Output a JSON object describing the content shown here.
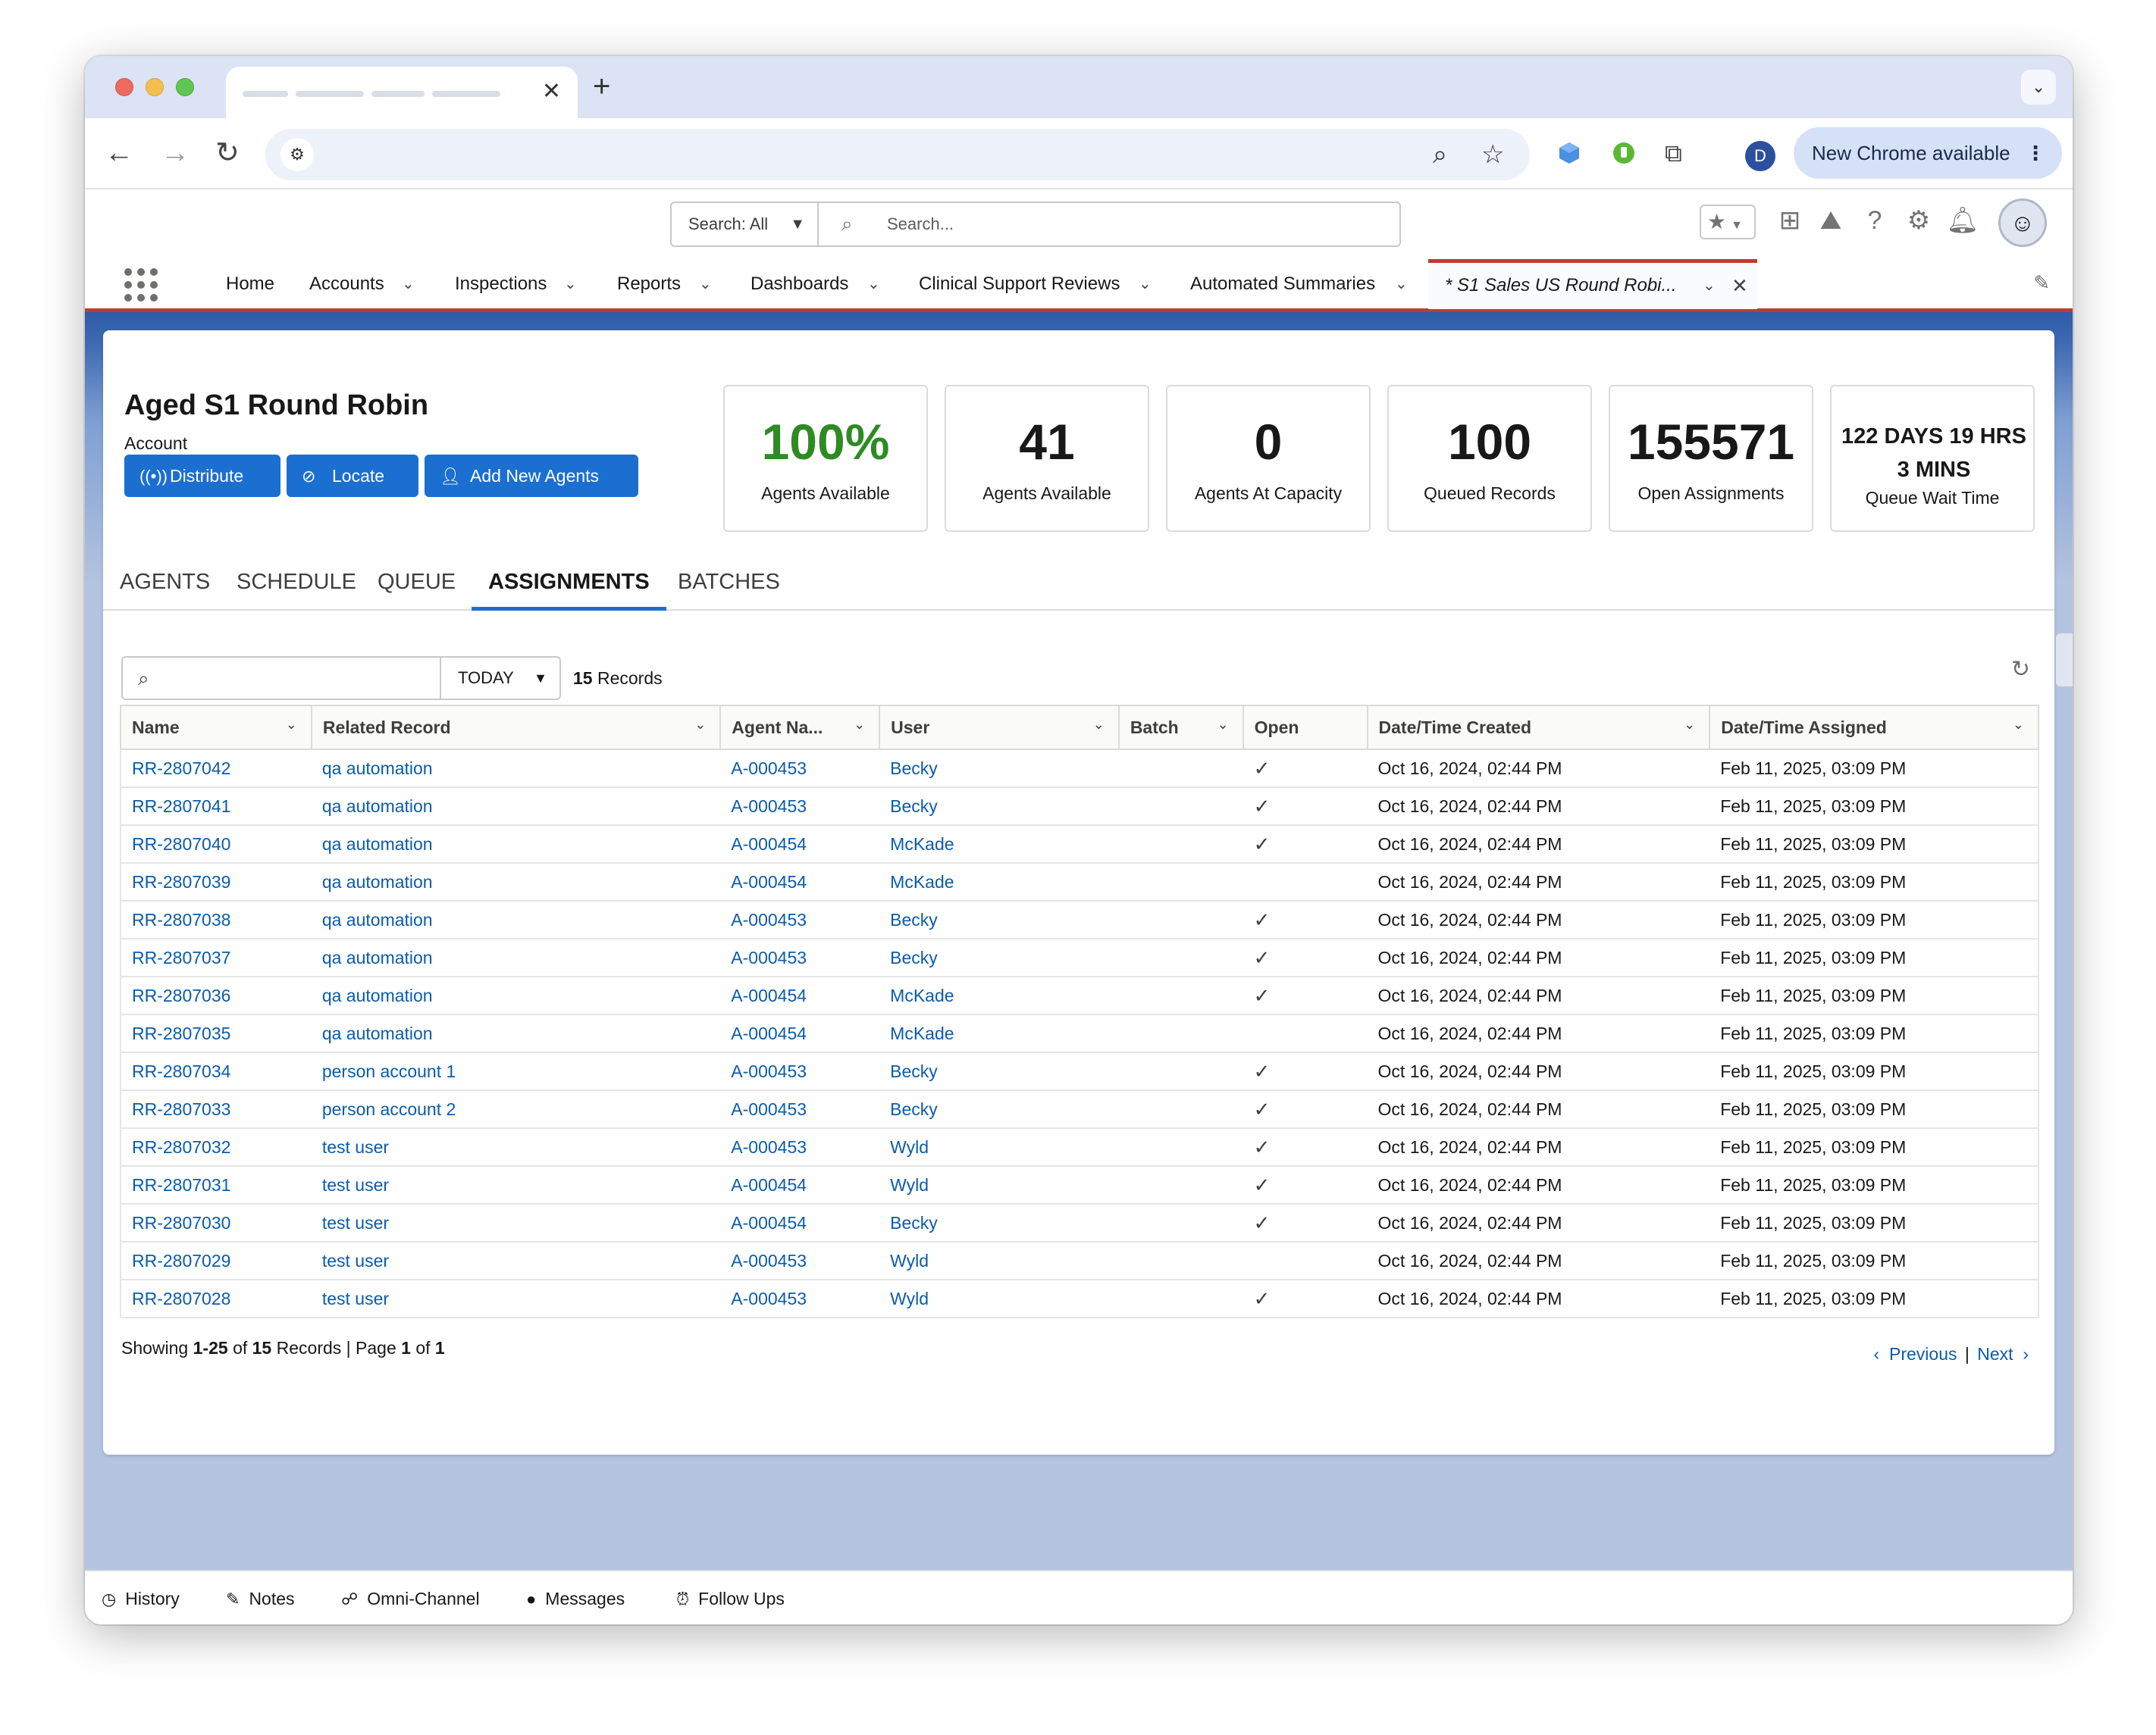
{
  "browser": {
    "new_chrome_label": "New Chrome available",
    "profile_initial": "D"
  },
  "header": {
    "search_scope": "Search: All",
    "search_placeholder": "Search..."
  },
  "nav": {
    "items": [
      "Home",
      "Accounts",
      "Inspections",
      "Reports",
      "Dashboards",
      "Clinical Support Reviews",
      "Automated Summaries"
    ],
    "active_tab": "* S1 Sales US Round Robi..."
  },
  "page": {
    "title": "Aged S1 Round Robin",
    "subtitle": "Account",
    "buttons": {
      "distribute": "Distribute",
      "locate": "Locate",
      "add_agents": "Add New Agents"
    }
  },
  "stats": [
    {
      "value": "100%",
      "label": "Agents Available",
      "color": "#2e8b24"
    },
    {
      "value": "41",
      "label": "Agents Available"
    },
    {
      "value": "0",
      "label": "Agents At Capacity"
    },
    {
      "value": "100",
      "label": "Queued Records"
    },
    {
      "value": "155571",
      "label": "Open Assignments"
    },
    {
      "value": "122 DAYS 19 HRS 3 MINS",
      "label": "Queue Wait Time"
    }
  ],
  "tabs": [
    "AGENTS",
    "SCHEDULE",
    "QUEUE",
    "ASSIGNMENTS",
    "BATCHES"
  ],
  "active_tab": "ASSIGNMENTS",
  "filter": {
    "date_option": "TODAY",
    "records_count": "15",
    "records_label": "Records"
  },
  "table": {
    "columns": [
      "Name",
      "Related Record",
      "Agent Na...",
      "User",
      "Batch",
      "Open",
      "Date/Time Created",
      "Date/Time Assigned"
    ],
    "rows": [
      {
        "name": "RR-2807042",
        "related": "qa automation",
        "agent": "A-000453",
        "user": "Becky",
        "batch": "",
        "open": true,
        "created": "Oct 16, 2024, 02:44 PM",
        "assigned": "Feb 11, 2025, 03:09 PM"
      },
      {
        "name": "RR-2807041",
        "related": "qa automation",
        "agent": "A-000453",
        "user": "Becky",
        "batch": "",
        "open": true,
        "created": "Oct 16, 2024, 02:44 PM",
        "assigned": "Feb 11, 2025, 03:09 PM"
      },
      {
        "name": "RR-2807040",
        "related": "qa automation",
        "agent": "A-000454",
        "user": "McKade",
        "batch": "",
        "open": true,
        "created": "Oct 16, 2024, 02:44 PM",
        "assigned": "Feb 11, 2025, 03:09 PM"
      },
      {
        "name": "RR-2807039",
        "related": "qa automation",
        "agent": "A-000454",
        "user": "McKade",
        "batch": "",
        "open": false,
        "created": "Oct 16, 2024, 02:44 PM",
        "assigned": "Feb 11, 2025, 03:09 PM"
      },
      {
        "name": "RR-2807038",
        "related": "qa automation",
        "agent": "A-000453",
        "user": "Becky",
        "batch": "",
        "open": true,
        "created": "Oct 16, 2024, 02:44 PM",
        "assigned": "Feb 11, 2025, 03:09 PM"
      },
      {
        "name": "RR-2807037",
        "related": "qa automation",
        "agent": "A-000453",
        "user": "Becky",
        "batch": "",
        "open": true,
        "created": "Oct 16, 2024, 02:44 PM",
        "assigned": "Feb 11, 2025, 03:09 PM"
      },
      {
        "name": "RR-2807036",
        "related": "qa automation",
        "agent": "A-000454",
        "user": "McKade",
        "batch": "",
        "open": true,
        "created": "Oct 16, 2024, 02:44 PM",
        "assigned": "Feb 11, 2025, 03:09 PM"
      },
      {
        "name": "RR-2807035",
        "related": "qa automation",
        "agent": "A-000454",
        "user": "McKade",
        "batch": "",
        "open": false,
        "created": "Oct 16, 2024, 02:44 PM",
        "assigned": "Feb 11, 2025, 03:09 PM"
      },
      {
        "name": "RR-2807034",
        "related": "person account 1",
        "agent": "A-000453",
        "user": "Becky",
        "batch": "",
        "open": true,
        "created": "Oct 16, 2024, 02:44 PM",
        "assigned": "Feb 11, 2025, 03:09 PM"
      },
      {
        "name": "RR-2807033",
        "related": "person account 2",
        "agent": "A-000453",
        "user": "Becky",
        "batch": "",
        "open": true,
        "created": "Oct 16, 2024, 02:44 PM",
        "assigned": "Feb 11, 2025, 03:09 PM"
      },
      {
        "name": "RR-2807032",
        "related": "test user",
        "agent": "A-000453",
        "user": "Wyld",
        "batch": "",
        "open": true,
        "created": "Oct 16, 2024, 02:44 PM",
        "assigned": "Feb 11, 2025, 03:09 PM"
      },
      {
        "name": "RR-2807031",
        "related": "test user",
        "agent": "A-000454",
        "user": "Wyld",
        "batch": "",
        "open": true,
        "created": "Oct 16, 2024, 02:44 PM",
        "assigned": "Feb 11, 2025, 03:09 PM"
      },
      {
        "name": "RR-2807030",
        "related": "test user",
        "agent": "A-000454",
        "user": "Becky",
        "batch": "",
        "open": true,
        "created": "Oct 16, 2024, 02:44 PM",
        "assigned": "Feb 11, 2025, 03:09 PM"
      },
      {
        "name": "RR-2807029",
        "related": "test user",
        "agent": "A-000453",
        "user": "Wyld",
        "batch": "",
        "open": false,
        "created": "Oct 16, 2024, 02:44 PM",
        "assigned": "Feb 11, 2025, 03:09 PM"
      },
      {
        "name": "RR-2807028",
        "related": "test user",
        "agent": "A-000453",
        "user": "Wyld",
        "batch": "",
        "open": true,
        "created": "Oct 16, 2024, 02:44 PM",
        "assigned": "Feb 11, 2025, 03:09 PM"
      }
    ]
  },
  "footer": {
    "showing_prefix": "Showing",
    "showing_range": "1-25",
    "of_label": "of",
    "total": "15",
    "records_page": "Records | Page",
    "page": "1",
    "pages": "1",
    "previous": "Previous",
    "separator": "|",
    "next": "Next"
  },
  "utility": [
    "History",
    "Notes",
    "Omni-Channel",
    "Messages",
    "Follow Ups"
  ],
  "colors": {
    "accent": "#1b6fd1",
    "link": "#0b5cab",
    "green": "#2e8b24",
    "nav_active_border": "#c23934"
  }
}
